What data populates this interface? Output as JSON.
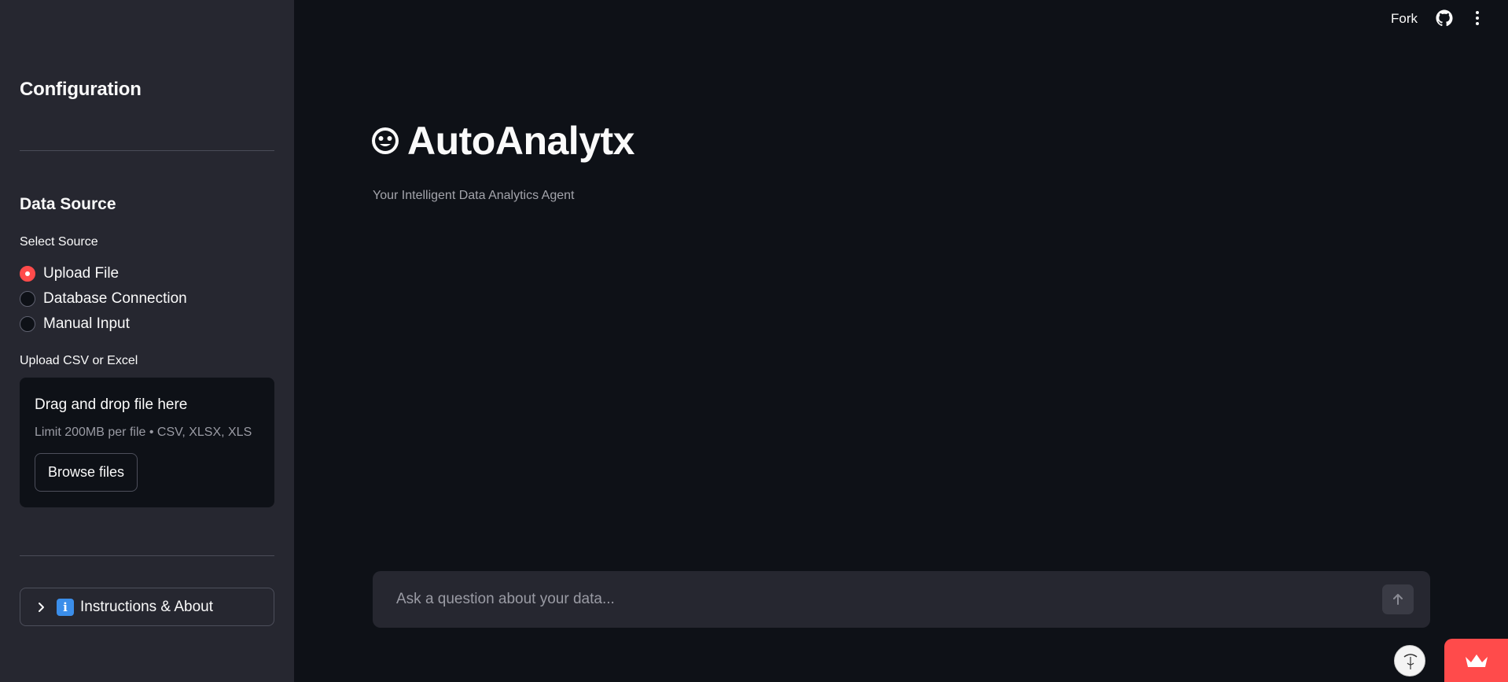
{
  "sidebar": {
    "title": "Configuration",
    "section_title": "Data Source",
    "select_label": "Select Source",
    "options": [
      {
        "label": "Upload File",
        "selected": true
      },
      {
        "label": "Database Connection",
        "selected": false
      },
      {
        "label": "Manual Input",
        "selected": false
      }
    ],
    "upload": {
      "label": "Upload CSV or Excel",
      "dropzone_title": "Drag and drop file here",
      "limit_text": "Limit 200MB per file • CSV, XLSX, XLS",
      "browse_label": "Browse files"
    },
    "expander": {
      "icon": "info-icon",
      "icon_glyph": "i",
      "label": "Instructions & About"
    }
  },
  "header": {
    "fork_label": "Fork",
    "icons": [
      "github-icon",
      "more-vertical-icon"
    ]
  },
  "main": {
    "title": "AutoAnalytx",
    "title_icon": "robot-face-icon",
    "subtitle": "Your Intelligent Data Analytics Agent",
    "chat": {
      "placeholder": "Ask a question about your data...",
      "send_icon": "arrow-up-icon"
    }
  },
  "footer": {
    "avatar_icon": "user-avatar-icon",
    "badge_icon": "crown-icon"
  },
  "colors": {
    "background": "#0e1117",
    "sidebar": "#262730",
    "accent": "#ff4b4b",
    "text": "#fafafa"
  }
}
